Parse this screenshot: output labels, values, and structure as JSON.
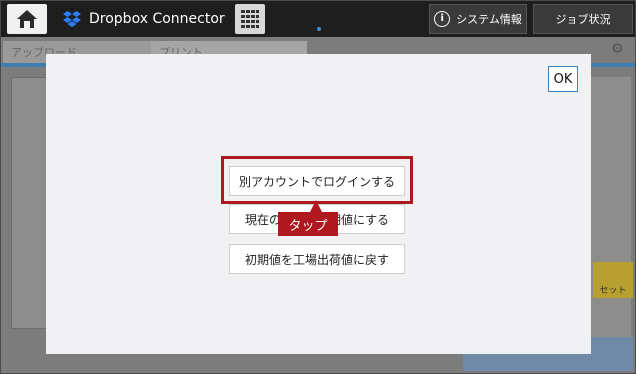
{
  "topbar": {
    "app_title": "Dropbox Connector",
    "system_info_label": "システム情報",
    "job_status_label": "ジョブ状況"
  },
  "background": {
    "tab_upload": "アップロード",
    "tab_print": "プリント",
    "right_count": "1",
    "reset_label": "セット"
  },
  "modal": {
    "ok_label": "OK",
    "options": [
      "別アカウントでログインする",
      "現在の設定を初期値にする",
      "初期値を工場出荷値に戻す"
    ],
    "callout_label": "タップ"
  },
  "colors": {
    "highlight": "#b0181f",
    "ok_border": "#3b82c4",
    "topbar": "#1e1e1e"
  }
}
